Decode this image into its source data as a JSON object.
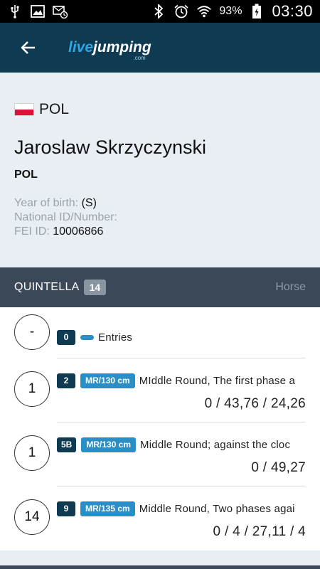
{
  "status_bar": {
    "battery": "93%",
    "time": "03:30",
    "icons": [
      "usb-icon",
      "image-icon",
      "email-icon",
      "bluetooth-icon",
      "alarm-icon",
      "wifi-icon",
      "battery-icon"
    ]
  },
  "app_bar": {
    "back_icon": "arrow-left-icon",
    "logo_live": "live",
    "logo_jumping": "jumping",
    "logo_com": ".com"
  },
  "rider": {
    "flag_nation": "POL",
    "name": "Jaroslaw Skrzyczynski",
    "nationality": "POL",
    "year_of_birth_label": "Year of birth:",
    "year_of_birth_value": "(S)",
    "national_id_label": "National ID/Number:",
    "fei_id_label": "FEI ID:",
    "fei_id_value": "10006866"
  },
  "horse": {
    "name": "QUINTELLA",
    "count": "14",
    "label": "Horse"
  },
  "entries": [
    {
      "rank": "-",
      "number": "0",
      "class": "",
      "description": "Entries",
      "result": ""
    },
    {
      "rank": "1",
      "number": "2",
      "class": "MR/130 cm",
      "description": "MIddle Round, The first phase a",
      "result": "0 / 43,76 / 24,26"
    },
    {
      "rank": "1",
      "number": "5B",
      "class": "MR/130 cm",
      "description": "Middle Round; against the cloc",
      "result": "0 / 49,27"
    },
    {
      "rank": "14",
      "number": "9",
      "class": "MR/135 cm",
      "description": "Middle Round, Two phases agai",
      "result": "0 / 4 / 27,11 / 4"
    }
  ],
  "colors": {
    "app_bar": "#0e3a52",
    "accent_blue": "#2a8fc6",
    "horse_bar": "#3b4858",
    "info_bg": "#e8eef3"
  }
}
